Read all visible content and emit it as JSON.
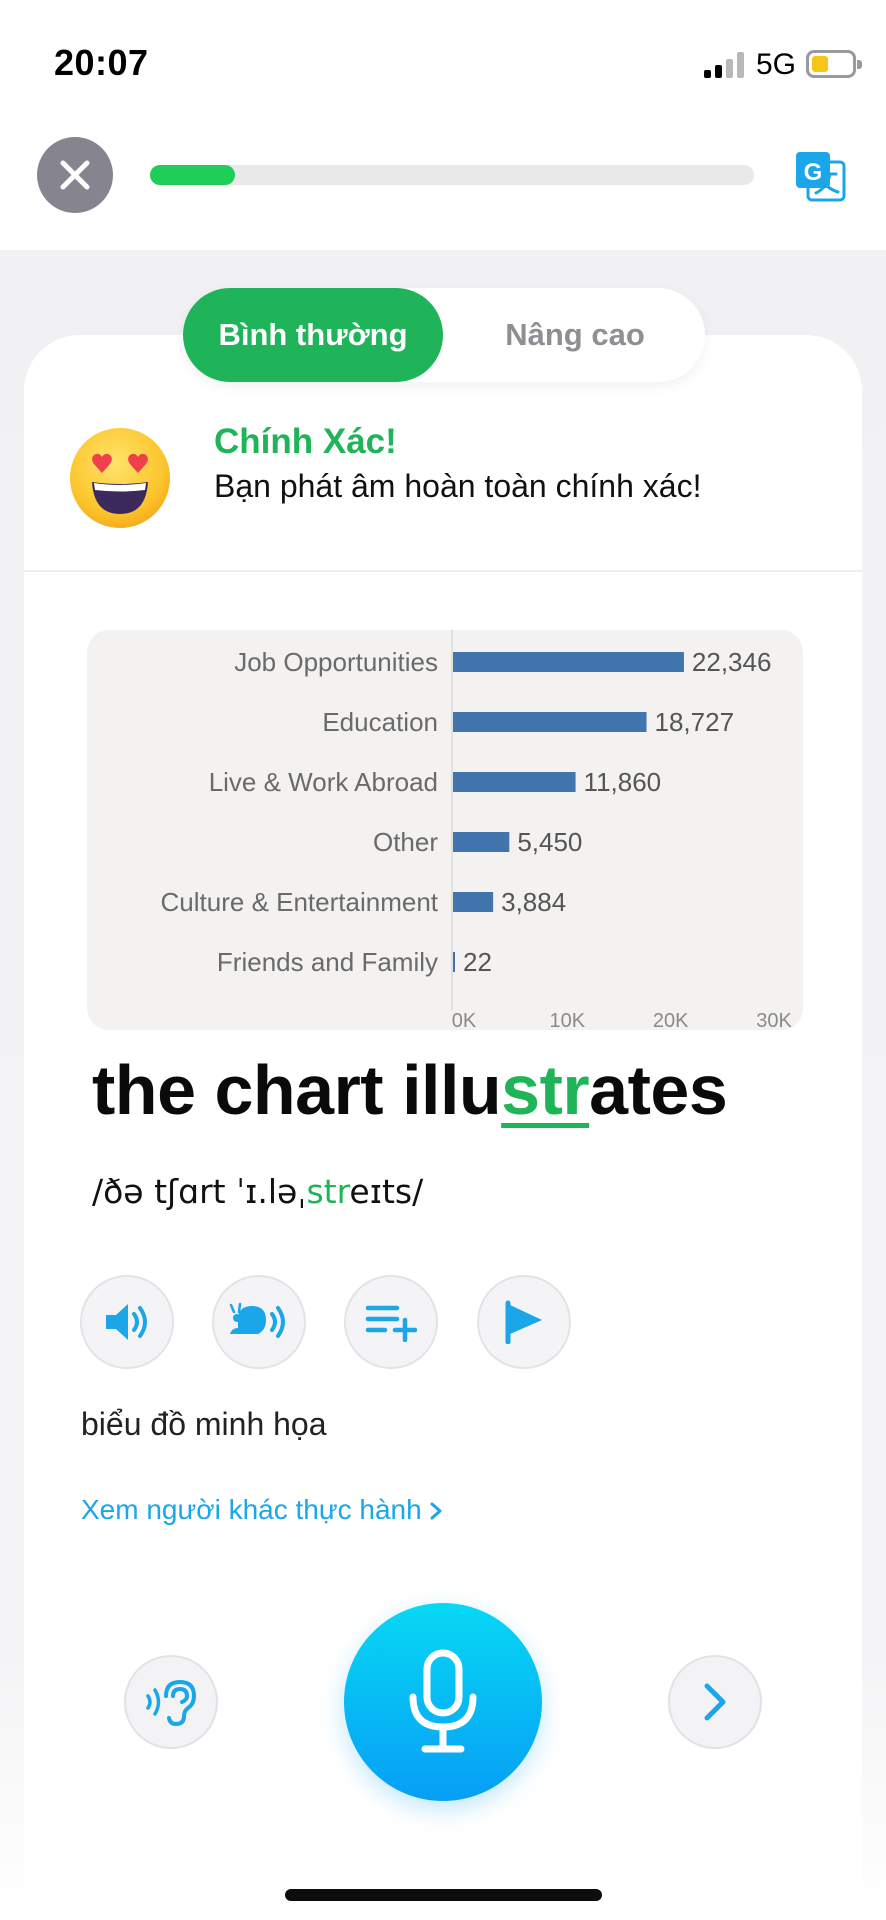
{
  "status_bar": {
    "time": "20:07",
    "network": "5G"
  },
  "progress": {
    "fraction": 0.14
  },
  "mode_toggle": {
    "normal_label": "Bình thường",
    "advanced_label": "Nâng cao",
    "selected": "normal"
  },
  "feedback": {
    "title": "Chính Xác!",
    "message": "Bạn phát âm hoàn toàn chính xác!"
  },
  "chart_data": {
    "type": "bar",
    "orientation": "horizontal",
    "categories": [
      "Job Opportunities",
      "Education",
      "Live & Work Abroad",
      "Other",
      "Culture & Entertainment",
      "Friends and Family"
    ],
    "values": [
      22346,
      18727,
      11860,
      5450,
      3884,
      22
    ],
    "value_labels": [
      "22,346",
      "18,727",
      "11,860",
      "5,450",
      "3,884",
      "22"
    ],
    "x_ticks": [
      "0K",
      "10K",
      "20K",
      "30K"
    ],
    "xlim": [
      0,
      30000
    ],
    "bar_color": "#4275ad",
    "grid": false
  },
  "phrase": {
    "before": "the chart illu",
    "highlight": "str",
    "after": "ates"
  },
  "ipa": {
    "before": "/ðə tʃɑrt ˈɪ.ləˌ",
    "highlight": "str",
    "after": "eɪts/"
  },
  "meaning": "biểu đồ minh họa",
  "see_others_link": "Xem người khác thực hành",
  "colors": {
    "accent_green": "#1fb457",
    "link_blue": "#1aa6e8",
    "mic_blue": "#07b6f5"
  },
  "icons": {
    "close": "close-icon",
    "translate": "translate-icon",
    "speaker": "speaker-icon",
    "slow": "snail-speaker-icon",
    "add_list": "playlist-add-icon",
    "flag": "flag-icon",
    "ear": "ear-listen-icon",
    "mic": "microphone-icon",
    "next": "chevron-right-icon"
  }
}
